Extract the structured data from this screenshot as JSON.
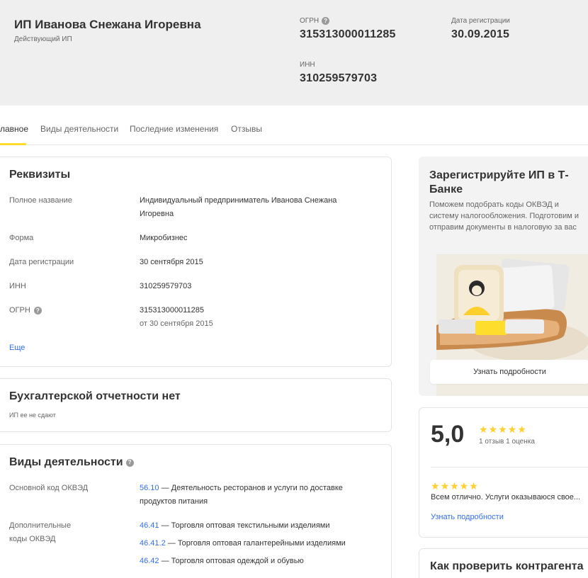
{
  "header": {
    "company_name": "ИП Иванова Снежана Игоревна",
    "status": "Действующий ИП",
    "ogrn_label": "ОГРН",
    "ogrn_value": "315313000011285",
    "reg_date_label": "Дата регистрации",
    "reg_date_value": "30.09.2015",
    "inn_label": "ИНН",
    "inn_value": "310259579703"
  },
  "tabs": [
    {
      "label": "лавное",
      "active": true
    },
    {
      "label": "Виды деятельности",
      "active": false
    },
    {
      "label": "Последние изменения",
      "active": false
    },
    {
      "label": "Отзывы",
      "active": false
    }
  ],
  "requisites": {
    "title": "Реквизиты",
    "full_name_label": "Полное название",
    "full_name_value": "Индивидуальный предприниматель Иванова Снежана Игоревна",
    "form_label": "Форма",
    "form_value": "Микробизнес",
    "reg_date_label": "Дата регистрации",
    "reg_date_value": "30 сентября 2015",
    "inn_label": "ИНН",
    "inn_value": "310259579703",
    "ogrn_label": "ОГРН",
    "ogrn_value": "315313000011285",
    "ogrn_date": "от 30 сентября 2015",
    "more_link": "Еще"
  },
  "accounting": {
    "title": "Бухгалтерской отчетности нет",
    "subtitle": "ИП ее не сдают"
  },
  "activities": {
    "title": "Виды деятельности",
    "main_label": "Основной код ОКВЭД",
    "main_code": "56.10",
    "main_text": " — Деятельность ресторанов и услуги по доставке продуктов питания",
    "additional_label": "Дополнительные коды ОКВЭД",
    "additional": [
      {
        "code": "46.41",
        "text": " — Торговля оптовая текстильными изделиями"
      },
      {
        "code": "46.41.2",
        "text": " — Торговля оптовая галантерейными изделиями"
      },
      {
        "code": "46.42",
        "text": " — Торговля оптовая одеждой и обувью"
      }
    ]
  },
  "promo": {
    "title": "Зарегистрируйте ИП в Т-Банке",
    "text": "Поможем подобрать коды ОКВЭД и систему налогообложения. Подготовим и отправим документы в налоговую за вас",
    "button": "Узнать подробности"
  },
  "rating": {
    "score": "5,0",
    "stars": "★★★★★",
    "meta": "1 отзыв   1 оценка",
    "review_stars": "★★★★★",
    "review_text": "Всем отлично. Услуги оказываюся свое...",
    "review_link": "Узнать подробности"
  },
  "check": {
    "title": "Как проверить контрагента"
  },
  "colors": {
    "accent": "#ffdd2d",
    "link": "#336fee",
    "star": "#ffcf2d",
    "header_bg": "#efefef"
  }
}
